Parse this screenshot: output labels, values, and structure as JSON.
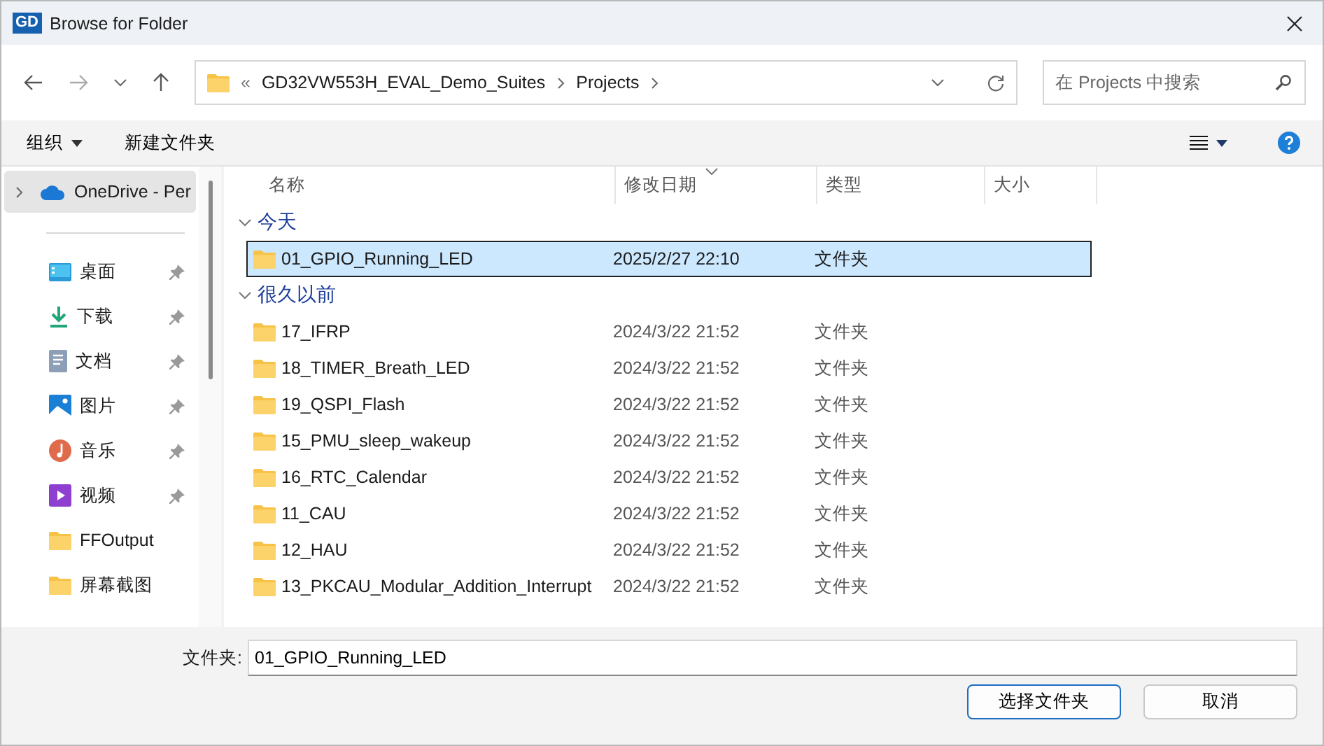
{
  "window": {
    "logo": "GD",
    "title": "Browse for Folder"
  },
  "nav": {
    "breadcrumb_overflow": "«",
    "path": [
      "GD32VW553H_EVAL_Demo_Suites",
      "Projects"
    ],
    "search_placeholder": "在 Projects 中搜索"
  },
  "toolbar": {
    "organize": "组织",
    "new_folder": "新建文件夹"
  },
  "sidebar": {
    "items": [
      {
        "kind": "cloud",
        "label": "OneDrive - Per",
        "pinned": false,
        "selected": true,
        "expandable": true
      },
      {
        "kind": "desktop",
        "label": "桌面",
        "pinned": true,
        "selected": false,
        "expandable": false
      },
      {
        "kind": "download",
        "label": "下载",
        "pinned": true,
        "selected": false,
        "expandable": false
      },
      {
        "kind": "document",
        "label": "文档",
        "pinned": true,
        "selected": false,
        "expandable": false
      },
      {
        "kind": "picture",
        "label": "图片",
        "pinned": true,
        "selected": false,
        "expandable": false
      },
      {
        "kind": "music",
        "label": "音乐",
        "pinned": true,
        "selected": false,
        "expandable": false
      },
      {
        "kind": "video",
        "label": "视频",
        "pinned": true,
        "selected": false,
        "expandable": false
      },
      {
        "kind": "folder",
        "label": "FFOutput",
        "pinned": false,
        "selected": false,
        "expandable": false
      },
      {
        "kind": "folder",
        "label": "屏幕截图",
        "pinned": false,
        "selected": false,
        "expandable": false
      }
    ]
  },
  "table": {
    "columns": [
      {
        "label": "名称",
        "sorted": false
      },
      {
        "label": "修改日期",
        "sorted": true
      },
      {
        "label": "类型",
        "sorted": false
      },
      {
        "label": "大小",
        "sorted": false
      }
    ],
    "groups": [
      {
        "label": "今天",
        "expanded": true,
        "rows": [
          {
            "name": "01_GPIO_Running_LED",
            "modified": "2025/2/27 22:10",
            "type": "文件夹",
            "selected": true
          }
        ]
      },
      {
        "label": "很久以前",
        "expanded": true,
        "rows": [
          {
            "name": "17_IFRP",
            "modified": "2024/3/22 21:52",
            "type": "文件夹",
            "selected": false
          },
          {
            "name": "18_TIMER_Breath_LED",
            "modified": "2024/3/22 21:52",
            "type": "文件夹",
            "selected": false
          },
          {
            "name": "19_QSPI_Flash",
            "modified": "2024/3/22 21:52",
            "type": "文件夹",
            "selected": false
          },
          {
            "name": "15_PMU_sleep_wakeup",
            "modified": "2024/3/22 21:52",
            "type": "文件夹",
            "selected": false
          },
          {
            "name": "16_RTC_Calendar",
            "modified": "2024/3/22 21:52",
            "type": "文件夹",
            "selected": false
          },
          {
            "name": "11_CAU",
            "modified": "2024/3/22 21:52",
            "type": "文件夹",
            "selected": false
          },
          {
            "name": "12_HAU",
            "modified": "2024/3/22 21:52",
            "type": "文件夹",
            "selected": false
          },
          {
            "name": "13_PKCAU_Modular_Addition_Interrupt",
            "modified": "2024/3/22 21:52",
            "type": "文件夹",
            "selected": false
          }
        ]
      }
    ]
  },
  "footer": {
    "folder_label": "文件夹:",
    "folder_value": "01_GPIO_Running_LED",
    "buttons": [
      {
        "label": "选择文件夹",
        "default": true
      },
      {
        "label": "取消",
        "default": false
      }
    ]
  }
}
